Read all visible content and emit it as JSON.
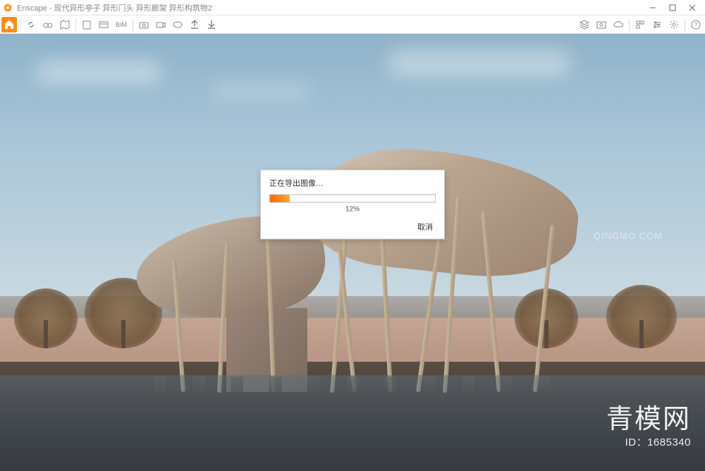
{
  "app": {
    "name": "Enscape",
    "title": "Enscape - 现代异形亭子 异形门头 异形廊架 异形构筑物2"
  },
  "toolbar": {
    "bim_label": "BIM"
  },
  "dialog": {
    "title": "正在导出图像…",
    "progress_percent": 12,
    "progress_label": "12%",
    "cancel_label": "取消"
  },
  "watermark": {
    "top_text": "QINGMO.COM",
    "logo_text": "青模网",
    "id_label": "ID：1685340"
  }
}
